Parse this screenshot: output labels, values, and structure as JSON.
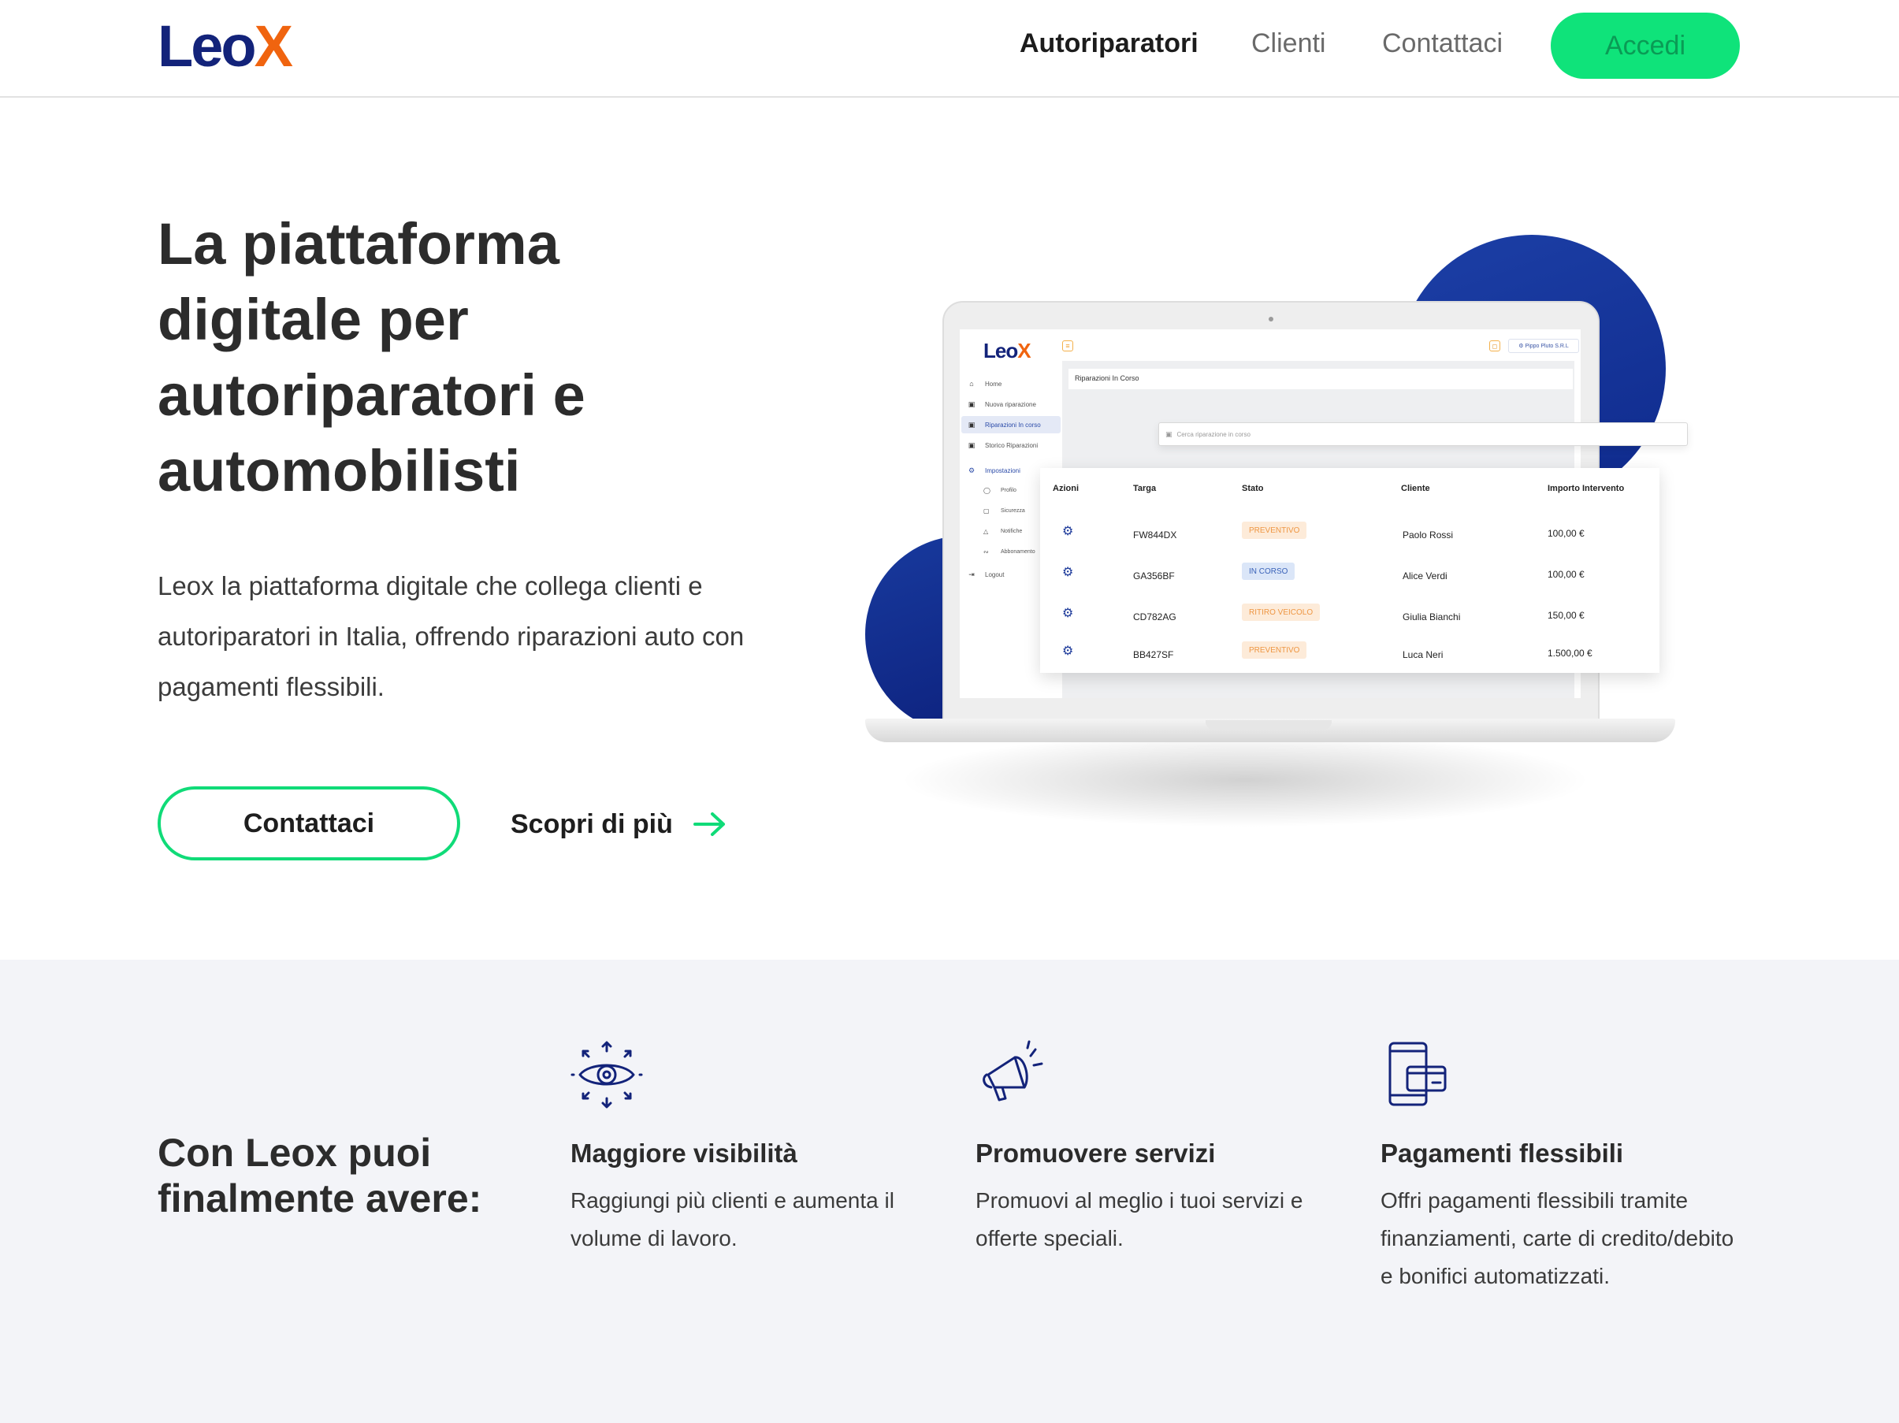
{
  "brand": {
    "logo_main": "Leo",
    "logo_accent": "X",
    "primary_color": "#13237a",
    "accent_color": "#f0640f",
    "cta_color": "#0fe37a"
  },
  "nav": {
    "items": [
      {
        "label": "Autoriparatori",
        "active": true
      },
      {
        "label": "Clienti",
        "active": false
      },
      {
        "label": "Contattaci",
        "active": false
      }
    ],
    "login_label": "Accedi"
  },
  "hero": {
    "title": "La piattaforma digitale per autoriparatori e automobilisti",
    "description": "Leox la piattaforma digitale che collega clienti e autoriparatori in Italia, offrendo riparazioni auto con pagamenti flessibili.",
    "contact_label": "Contattaci",
    "discover_label": "Scopri di più"
  },
  "mockup": {
    "logo_main": "Leo",
    "logo_accent": "X",
    "company": "Pippo Pluto S.R.L",
    "sidebar": [
      {
        "label": "Home",
        "icon": "home-icon"
      },
      {
        "label": "Nuova riparazione",
        "icon": "car-icon"
      },
      {
        "label": "Riparazioni In corso",
        "icon": "car-icon",
        "active": true
      },
      {
        "label": "Storico Riparazioni",
        "icon": "car-icon"
      },
      {
        "label": "Impostazioni",
        "icon": "gear-icon"
      }
    ],
    "settings_items": [
      {
        "label": "Profilo",
        "icon": "user-icon"
      },
      {
        "label": "Sicurezza",
        "icon": "lock-icon"
      },
      {
        "label": "Notifiche",
        "icon": "bell-icon"
      },
      {
        "label": "Abbonamento",
        "icon": "subscription-icon"
      }
    ],
    "logout_label": "Logout",
    "page_title": "Riparazioni In Corso",
    "search_placeholder": "Cerca riparazione in corso",
    "table": {
      "headers": [
        "Azioni",
        "Targa",
        "Stato",
        "Cliente",
        "Importo Intervento"
      ],
      "rows": [
        {
          "targa": "FW844DX",
          "stato": "PREVENTIVO",
          "stato_color": "orange",
          "cliente": "Paolo Rossi",
          "importo": "100,00 €"
        },
        {
          "targa": "GA356BF",
          "stato": "IN CORSO",
          "stato_color": "blue",
          "cliente": "Alice Verdi",
          "importo": "100,00 €"
        },
        {
          "targa": "CD782AG",
          "stato": "RITIRO VEICOLO",
          "stato_color": "orange",
          "cliente": "Giulia Bianchi",
          "importo": "150,00 €"
        },
        {
          "targa": "BB427SF",
          "stato": "PREVENTIVO",
          "stato_color": "orange",
          "cliente": "Luca Neri",
          "importo": "1.500,00 €"
        }
      ]
    }
  },
  "features": {
    "heading": "Con Leox puoi finalmente avere:",
    "items": [
      {
        "icon": "eye-icon",
        "title": "Maggiore visibilità",
        "text": "Raggiungi più clienti e aumenta il volume di lavoro."
      },
      {
        "icon": "megaphone-icon",
        "title": "Promuovere servizi",
        "text": "Promuovi al meglio i tuoi servizi e offerte speciali."
      },
      {
        "icon": "payment-card-icon",
        "title": "Pagamenti flessibili",
        "text": "Offri pagamenti flessibili tramite finanziamenti, carte di credito/debito e bonifici automatizzati."
      }
    ]
  }
}
